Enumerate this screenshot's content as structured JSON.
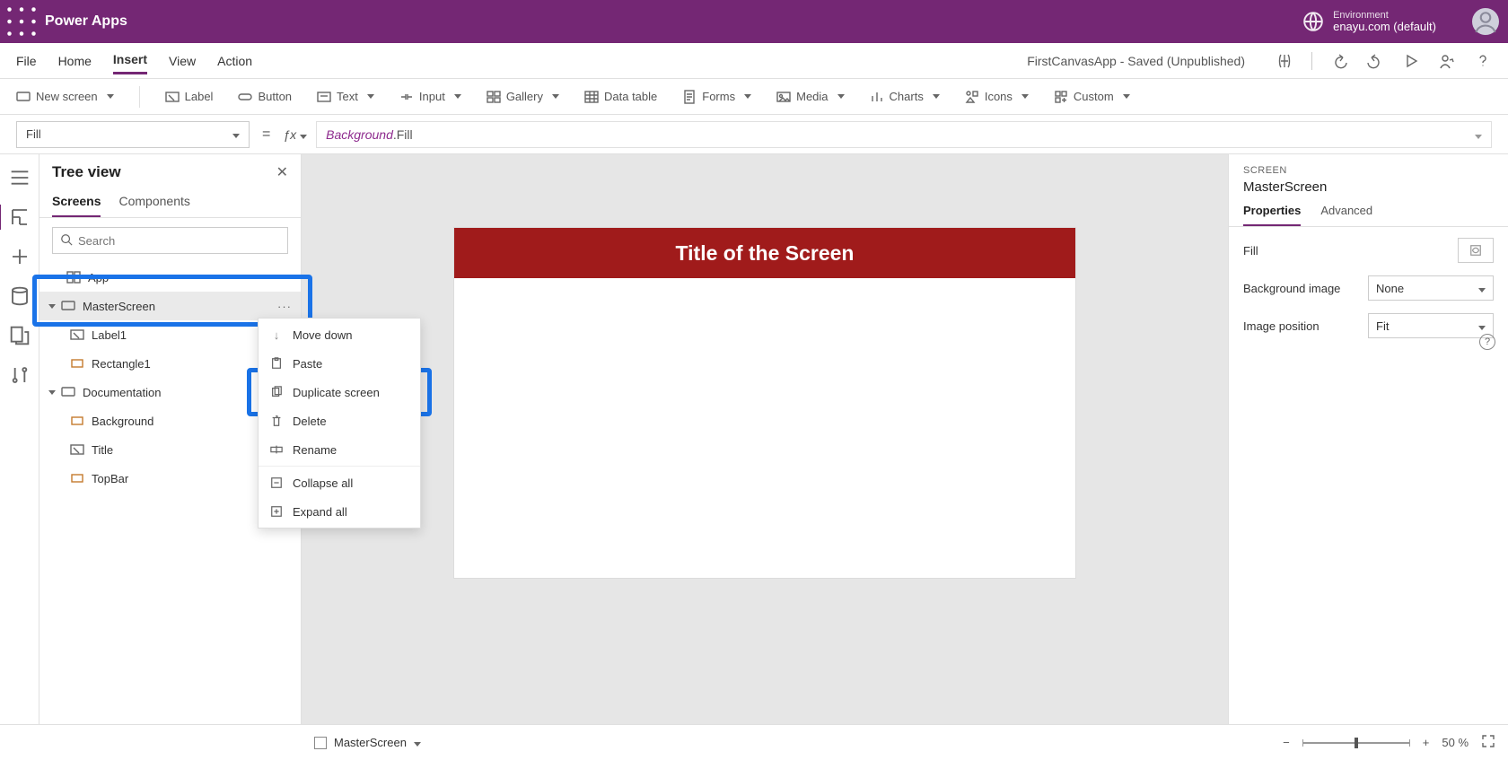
{
  "header": {
    "brand": "Power Apps",
    "env_label": "Environment",
    "env_value": "enayu.com (default)"
  },
  "menu": {
    "items": [
      "File",
      "Home",
      "Insert",
      "View",
      "Action"
    ],
    "active": "Insert",
    "status": "FirstCanvasApp - Saved (Unpublished)"
  },
  "ribbon": {
    "new_screen": "New screen",
    "label": "Label",
    "button": "Button",
    "text": "Text",
    "input": "Input",
    "gallery": "Gallery",
    "data_table": "Data table",
    "forms": "Forms",
    "media": "Media",
    "charts": "Charts",
    "icons": "Icons",
    "custom": "Custom"
  },
  "formula": {
    "property": "Fill",
    "object": "Background",
    "member": ".Fill"
  },
  "tree": {
    "title": "Tree view",
    "tabs": {
      "screens": "Screens",
      "components": "Components"
    },
    "search_placeholder": "Search",
    "nodes": {
      "app": "App",
      "master": "MasterScreen",
      "label1": "Label1",
      "rect1": "Rectangle1",
      "doc": "Documentation",
      "background": "Background",
      "title": "Title",
      "topbar": "TopBar"
    }
  },
  "context_menu": {
    "move_down": "Move down",
    "paste": "Paste",
    "duplicate": "Duplicate screen",
    "delete": "Delete",
    "rename": "Rename",
    "collapse": "Collapse all",
    "expand": "Expand all"
  },
  "canvas": {
    "title_text": "Title of the Screen"
  },
  "properties": {
    "kicker": "SCREEN",
    "name": "MasterScreen",
    "tabs": {
      "properties": "Properties",
      "advanced": "Advanced"
    },
    "fill_label": "Fill",
    "bg_image_label": "Background image",
    "bg_image_value": "None",
    "img_pos_label": "Image position",
    "img_pos_value": "Fit"
  },
  "status": {
    "screen": "MasterScreen",
    "zoom_value": "50",
    "zoom_pct": "%"
  }
}
